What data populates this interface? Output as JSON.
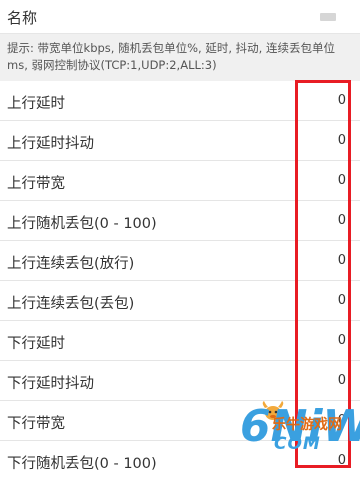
{
  "name_row": {
    "label": "名称"
  },
  "hint": {
    "text": "提示: 带宽单位kbps, 随机丢包单位%, 延时, 抖动, 连续丢包单位ms, 弱网控制协议(TCP:1,UDP:2,ALL:3)"
  },
  "rows": [
    {
      "label": "上行延时",
      "value": "0"
    },
    {
      "label": "上行延时抖动",
      "value": "0"
    },
    {
      "label": "上行带宽",
      "value": "0"
    },
    {
      "label": "上行随机丢包(0 - 100)",
      "value": "0"
    },
    {
      "label": "上行连续丢包(放行)",
      "value": "0"
    },
    {
      "label": "上行连续丢包(丢包)",
      "value": "0"
    },
    {
      "label": "下行延时",
      "value": "0"
    },
    {
      "label": "下行延时抖动",
      "value": "0"
    },
    {
      "label": "下行带宽",
      "value": "0"
    },
    {
      "label": "下行随机丢包(0 - 100)",
      "value": "0"
    }
  ],
  "highlight": {
    "color": "#e81c24"
  },
  "watermark": {
    "logo": "6NiW",
    "cn": "乐牛游戏网",
    "en": "COM"
  }
}
